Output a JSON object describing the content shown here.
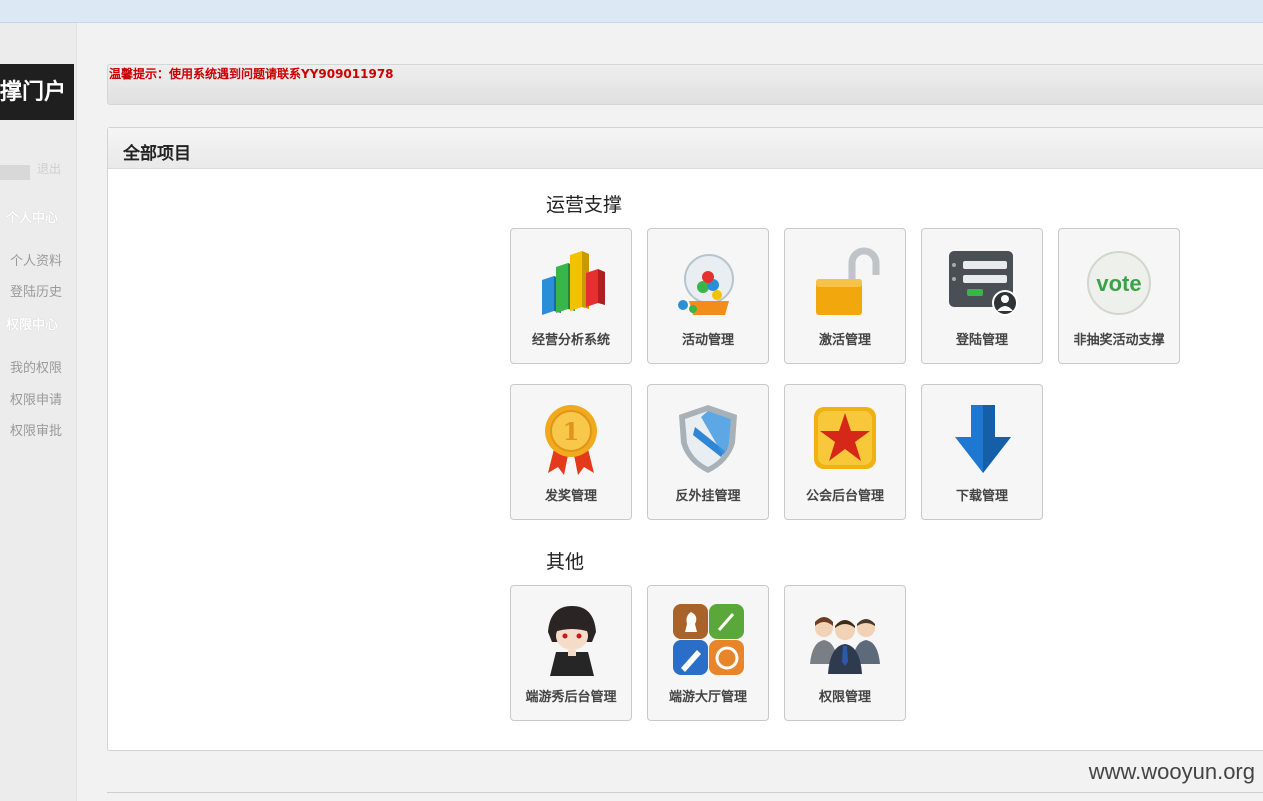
{
  "sidebar": {
    "brand": "撑门户",
    "logout": "退出",
    "section_personal": "个人中心",
    "personal_items": [
      "个人资料",
      "登陆历史"
    ],
    "section_permission": "权限中心",
    "permission_items": [
      "我的权限",
      "权限申请",
      "权限审批"
    ]
  },
  "notice": "温馨提示：使用系统遇到问题请联系YY909011978",
  "panel": {
    "title": "全部项目",
    "groups": [
      {
        "title": "运营支撑",
        "items": [
          {
            "label": "经营分析系统",
            "icon": "bar-chart-icon"
          },
          {
            "label": "活动管理",
            "icon": "lottery-machine-icon"
          },
          {
            "label": "激活管理",
            "icon": "unlock-icon"
          },
          {
            "label": "登陆管理",
            "icon": "login-form-icon"
          },
          {
            "label": "非抽奖活动支撑",
            "icon": "vote-icon"
          },
          {
            "label": "发奖管理",
            "icon": "medal-icon"
          },
          {
            "label": "反外挂管理",
            "icon": "shield-icon"
          },
          {
            "label": "公会后台管理",
            "icon": "star-icon"
          },
          {
            "label": "下载管理",
            "icon": "download-arrow-icon"
          }
        ]
      },
      {
        "title": "其他",
        "items": [
          {
            "label": "端游秀后台管理",
            "icon": "anime-avatar-icon"
          },
          {
            "label": "端游大厅管理",
            "icon": "game-center-icon"
          },
          {
            "label": "权限管理",
            "icon": "people-icon"
          }
        ]
      }
    ]
  },
  "watermark": "www.wooyun.org",
  "colors": {
    "notice": "#cc0000",
    "brand_bg": "#1f1f1f",
    "tile_bg": "#f6f6f6"
  }
}
